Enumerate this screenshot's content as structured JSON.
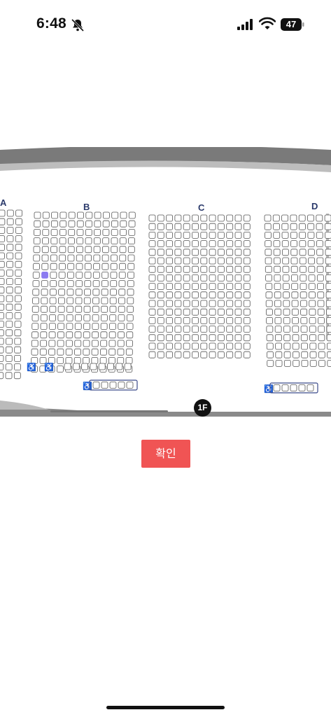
{
  "status_bar": {
    "time": "6:48",
    "battery": "47",
    "icons": [
      "bell-slash-icon",
      "cellular-signal-icon",
      "wifi-icon",
      "battery-icon"
    ]
  },
  "seat_map": {
    "sections": [
      "A",
      "B",
      "C",
      "D"
    ],
    "floor": "1F",
    "icons": [
      "wheelchair-icon"
    ],
    "colors": {
      "selected_seat": "#8c7cf0",
      "seat_outline": "#555555",
      "wheelchair_box": "#3b4a8a",
      "stage_arc": "#777777"
    },
    "selected_seat": {
      "section": "B",
      "row": 7,
      "column": 1
    }
  },
  "confirm_button": {
    "label": "확인"
  }
}
